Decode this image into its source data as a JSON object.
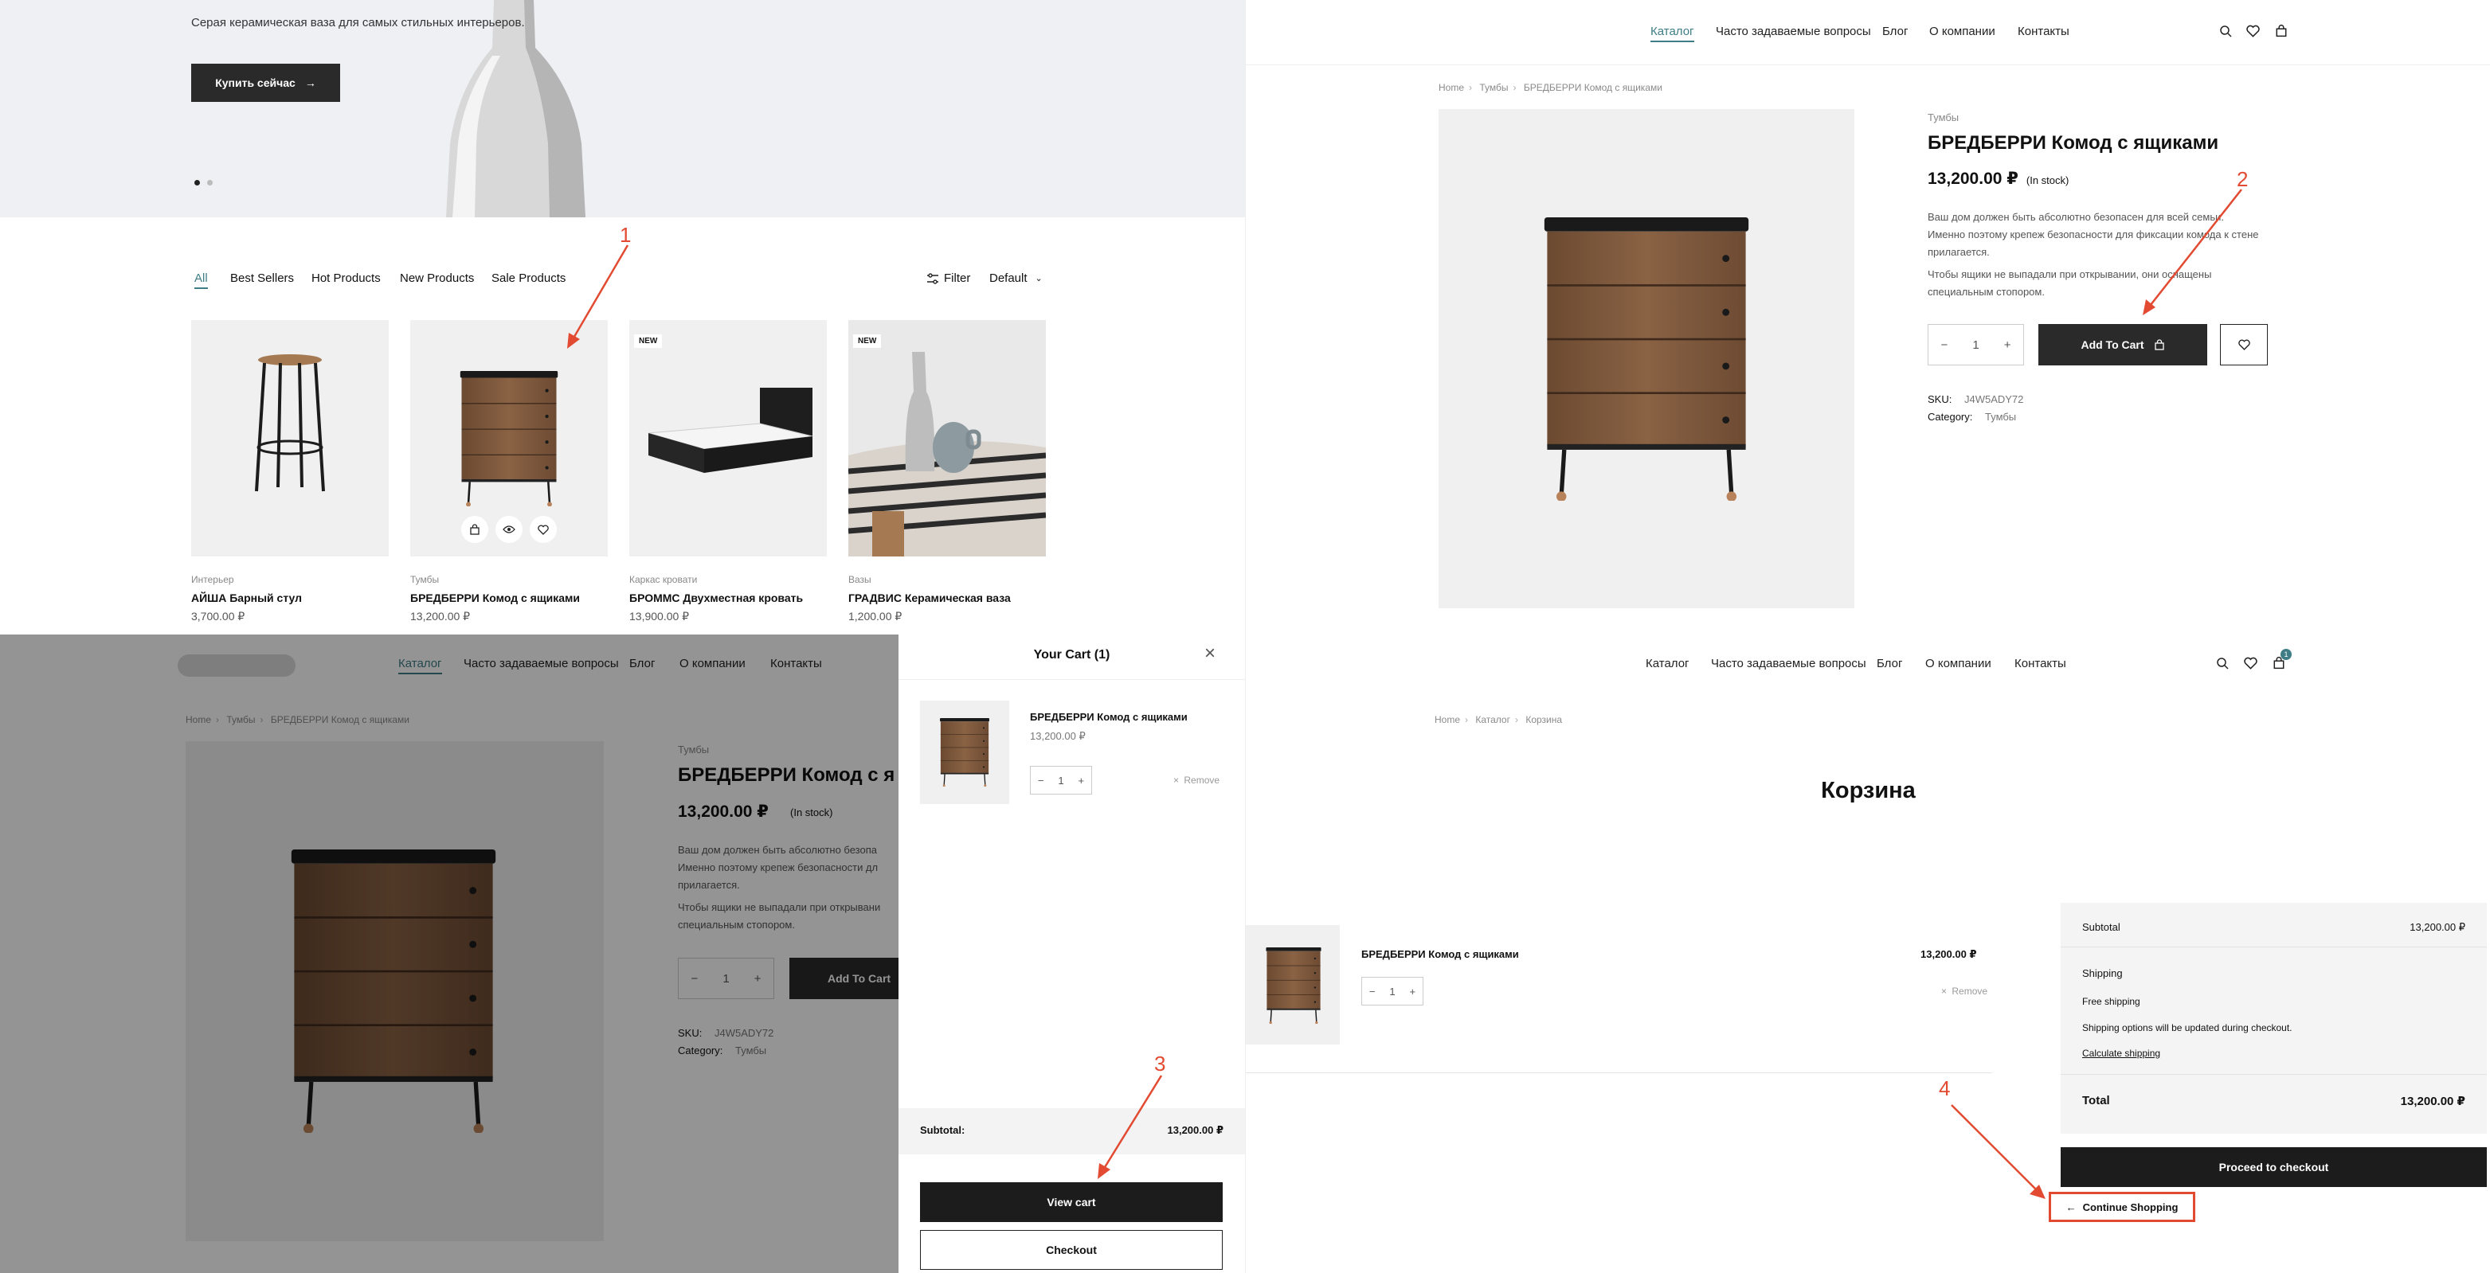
{
  "colors": {
    "accent": "#3e7d86",
    "dark_button": "#2a2a2a",
    "annotation": "#e24b32",
    "image_bg": "#f0f0f0"
  },
  "hero": {
    "subtitle": "Серая керамическая ваза для самых стильных интерьеров.",
    "cta_label": "Купить сейчас",
    "cta_arrow": "→"
  },
  "filters": {
    "tabs": [
      "All",
      "Best Sellers",
      "Hot Products",
      "New Products",
      "Sale Products"
    ],
    "filter_label": "Filter",
    "sort_label": "Default"
  },
  "products": [
    {
      "category": "Интерьер",
      "name": "АЙША Барный стул",
      "price": "3,700.00 ₽",
      "badge": ""
    },
    {
      "category": "Тумбы",
      "name": "БРЕДБЕРРИ Комод с ящиками",
      "price": "13,200.00 ₽",
      "badge": ""
    },
    {
      "category": "Каркас кровати",
      "name": "БРОММС Двухместная кровать",
      "price": "13,900.00 ₽",
      "badge": "NEW"
    },
    {
      "category": "Вазы",
      "name": "ГРАДВИС Керамическая ваза",
      "price": "1,200.00 ₽",
      "badge": "NEW"
    }
  ],
  "nav": {
    "items": [
      "Каталог",
      "Часто задаваемые вопросы",
      "Блог",
      "О компании",
      "Контакты"
    ],
    "cart_count": "1"
  },
  "product_page": {
    "breadcrumb": [
      "Home",
      "Тумбы",
      "БРЕДБЕРРИ Комод с ящиками"
    ],
    "category": "Тумбы",
    "title": "БРЕДБЕРРИ Комод с ящиками",
    "title_cut": "БРЕДБЕРРИ Комод с я",
    "price": "13,200.00 ₽",
    "stock": "(In stock)",
    "desc1": "Ваш дом должен быть абсолютно безопасен для всей семьи. Именно поэтому крепеж безопасности для фиксации комода к стене прилагается.",
    "desc1_lines": [
      "Ваш дом должен быть абсолютно безопасен для всей семьи.",
      "Именно поэтому крепеж безопасности для фиксации комода к стене",
      "прилагается."
    ],
    "desc2_lines": [
      "Чтобы ящики не выпадали при открывании, они оснащены",
      "специальным стопором."
    ],
    "desc1_cut": [
      "Ваш дом должен быть абсолютно безопа",
      "Именно поэтому крепеж безопасности дл",
      "прилагается."
    ],
    "desc2_cut": [
      "Чтобы ящики не выпадали при открывани",
      "специальным стопором."
    ],
    "qty": "1",
    "add_to_cart": "Add To Cart",
    "sku_label": "SKU:",
    "sku": "J4W5ADY72",
    "category_label": "Category:",
    "category_value": "Тумбы"
  },
  "minicart": {
    "title": "Your Cart (1)",
    "item_name": "БРЕДБЕРРИ Комод с ящиками",
    "item_price": "13,200.00 ₽",
    "qty": "1",
    "remove": "Remove",
    "subtotal_label": "Subtotal:",
    "subtotal": "13,200.00 ₽",
    "view_cart": "View cart",
    "checkout": "Checkout"
  },
  "cart_page": {
    "breadcrumb": [
      "Home",
      "Каталог",
      "Корзина"
    ],
    "title": "Корзина",
    "item_name": "БРЕДБЕРРИ Комод с ящиками",
    "item_price": "13,200.00 ₽",
    "qty": "1",
    "remove": "Remove",
    "subtotal_label": "Subtotal",
    "subtotal": "13,200.00 ₽",
    "shipping_label": "Shipping",
    "free_shipping": "Free shipping",
    "shipping_note": "Shipping options will be updated during checkout.",
    "calc_shipping": "Calculate shipping",
    "total_label": "Total",
    "total": "13,200.00 ₽",
    "proceed": "Proceed to checkout",
    "continue": "Continue Shopping"
  },
  "annotations": [
    "1",
    "2",
    "3",
    "4"
  ]
}
